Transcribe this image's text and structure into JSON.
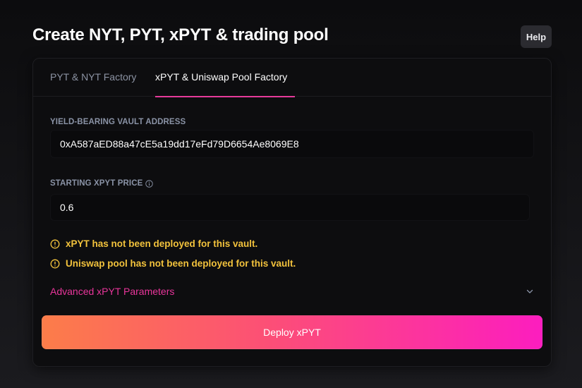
{
  "header": {
    "title": "Create NYT, PYT, xPYT & trading pool",
    "help_label": "Help"
  },
  "tabs": [
    {
      "label": "PYT & NYT Factory",
      "active": false
    },
    {
      "label": "xPYT & Uniswap Pool Factory",
      "active": true
    }
  ],
  "form": {
    "vault_label": "YIELD-BEARING VAULT ADDRESS",
    "vault_value": "0xA587aED88a47cE5a19dd17eFd79D6654Ae8069E8",
    "price_label": "STARTING XPYT PRICE",
    "price_value": "0.6"
  },
  "warnings": [
    "xPYT has not been deployed for this vault.",
    "Uniswap pool has not been deployed for this vault."
  ],
  "advanced": {
    "label": "Advanced xPYT Parameters",
    "icon": "chevron-down-icon"
  },
  "deploy": {
    "label": "Deploy xPYT"
  },
  "colors": {
    "accent": "#e9359b",
    "warning": "#f2c23c",
    "gradient_start": "#fc7d49",
    "gradient_end": "#fc1dbf"
  }
}
